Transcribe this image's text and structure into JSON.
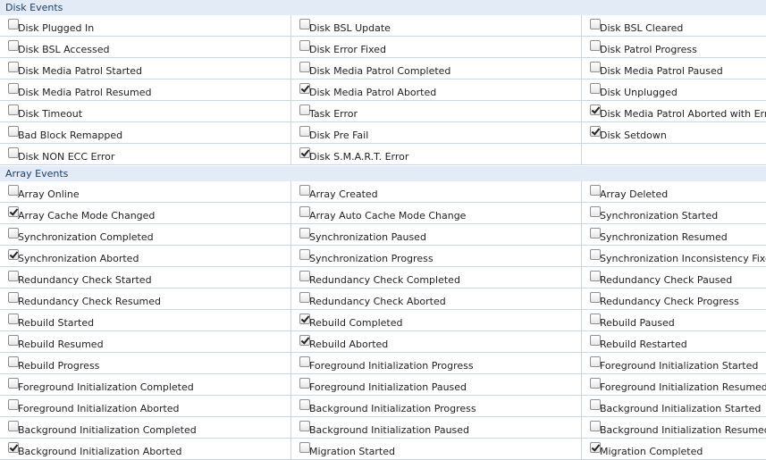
{
  "sections": [
    {
      "title": "Disk Events",
      "items": [
        {
          "label": "Disk Plugged In",
          "checked": false
        },
        {
          "label": "Disk BSL Update",
          "checked": false
        },
        {
          "label": "Disk BSL Cleared",
          "checked": false
        },
        {
          "label": "Disk BSL Accessed",
          "checked": false
        },
        {
          "label": "Disk Error Fixed",
          "checked": false
        },
        {
          "label": "Disk Patrol Progress",
          "checked": false
        },
        {
          "label": "Disk Media Patrol Started",
          "checked": false
        },
        {
          "label": "Disk Media Patrol Completed",
          "checked": false
        },
        {
          "label": "Disk Media Patrol Paused",
          "checked": false
        },
        {
          "label": "Disk Media Patrol Resumed",
          "checked": false
        },
        {
          "label": "Disk Media Patrol Aborted",
          "checked": true
        },
        {
          "label": "Disk Unplugged",
          "checked": false
        },
        {
          "label": "Disk Timeout",
          "checked": false
        },
        {
          "label": "Task Error",
          "checked": false
        },
        {
          "label": "Disk Media Patrol Aborted with Error",
          "checked": true
        },
        {
          "label": "Bad Block Remapped",
          "checked": false
        },
        {
          "label": "Disk Pre Fail",
          "checked": false
        },
        {
          "label": "Disk Setdown",
          "checked": true
        },
        {
          "label": "Disk NON ECC Error",
          "checked": false
        },
        {
          "label": "Disk S.M.A.R.T. Error",
          "checked": true
        },
        null
      ]
    },
    {
      "title": "Array Events",
      "items": [
        {
          "label": "Array Online",
          "checked": false
        },
        {
          "label": "Array Created",
          "checked": false
        },
        {
          "label": "Array Deleted",
          "checked": false
        },
        {
          "label": "Array Cache Mode Changed",
          "checked": true
        },
        {
          "label": "Array Auto Cache Mode Change",
          "checked": false
        },
        {
          "label": "Synchronization Started",
          "checked": false
        },
        {
          "label": "Synchronization Completed",
          "checked": false
        },
        {
          "label": "Synchronization Paused",
          "checked": false
        },
        {
          "label": "Synchronization Resumed",
          "checked": false
        },
        {
          "label": "Synchronization Aborted",
          "checked": true
        },
        {
          "label": "Synchronization Progress",
          "checked": false
        },
        {
          "label": "Synchronization Inconsistency Fixed",
          "checked": false
        },
        {
          "label": "Redundancy Check Started",
          "checked": false
        },
        {
          "label": "Redundancy Check Completed",
          "checked": false
        },
        {
          "label": "Redundancy Check Paused",
          "checked": false
        },
        {
          "label": "Redundancy Check Resumed",
          "checked": false
        },
        {
          "label": "Redundancy Check Aborted",
          "checked": false
        },
        {
          "label": "Redundancy Check Progress",
          "checked": false
        },
        {
          "label": "Rebuild Started",
          "checked": false
        },
        {
          "label": "Rebuild Completed",
          "checked": true
        },
        {
          "label": "Rebuild Paused",
          "checked": false
        },
        {
          "label": "Rebuild Resumed",
          "checked": false
        },
        {
          "label": "Rebuild Aborted",
          "checked": true
        },
        {
          "label": "Rebuild Restarted",
          "checked": false
        },
        {
          "label": "Rebuild Progress",
          "checked": false
        },
        {
          "label": "Foreground Initialization Progress",
          "checked": false
        },
        {
          "label": "Foreground Initialization Started",
          "checked": false
        },
        {
          "label": "Foreground Initialization Completed",
          "checked": false
        },
        {
          "label": "Foreground Initialization Paused",
          "checked": false
        },
        {
          "label": "Foreground Initialization Resumed",
          "checked": false
        },
        {
          "label": "Foreground Initialization Aborted",
          "checked": false
        },
        {
          "label": "Background Initialization Progress",
          "checked": false
        },
        {
          "label": "Background Initialization Started",
          "checked": false
        },
        {
          "label": "Background Initialization Completed",
          "checked": false
        },
        {
          "label": "Background Initialization Paused",
          "checked": false
        },
        {
          "label": "Background Initialization Resumed",
          "checked": false
        },
        {
          "label": "Background Initialization Aborted",
          "checked": true
        },
        {
          "label": "Migration Started",
          "checked": false
        },
        {
          "label": "Migration Completed",
          "checked": true
        }
      ]
    }
  ]
}
